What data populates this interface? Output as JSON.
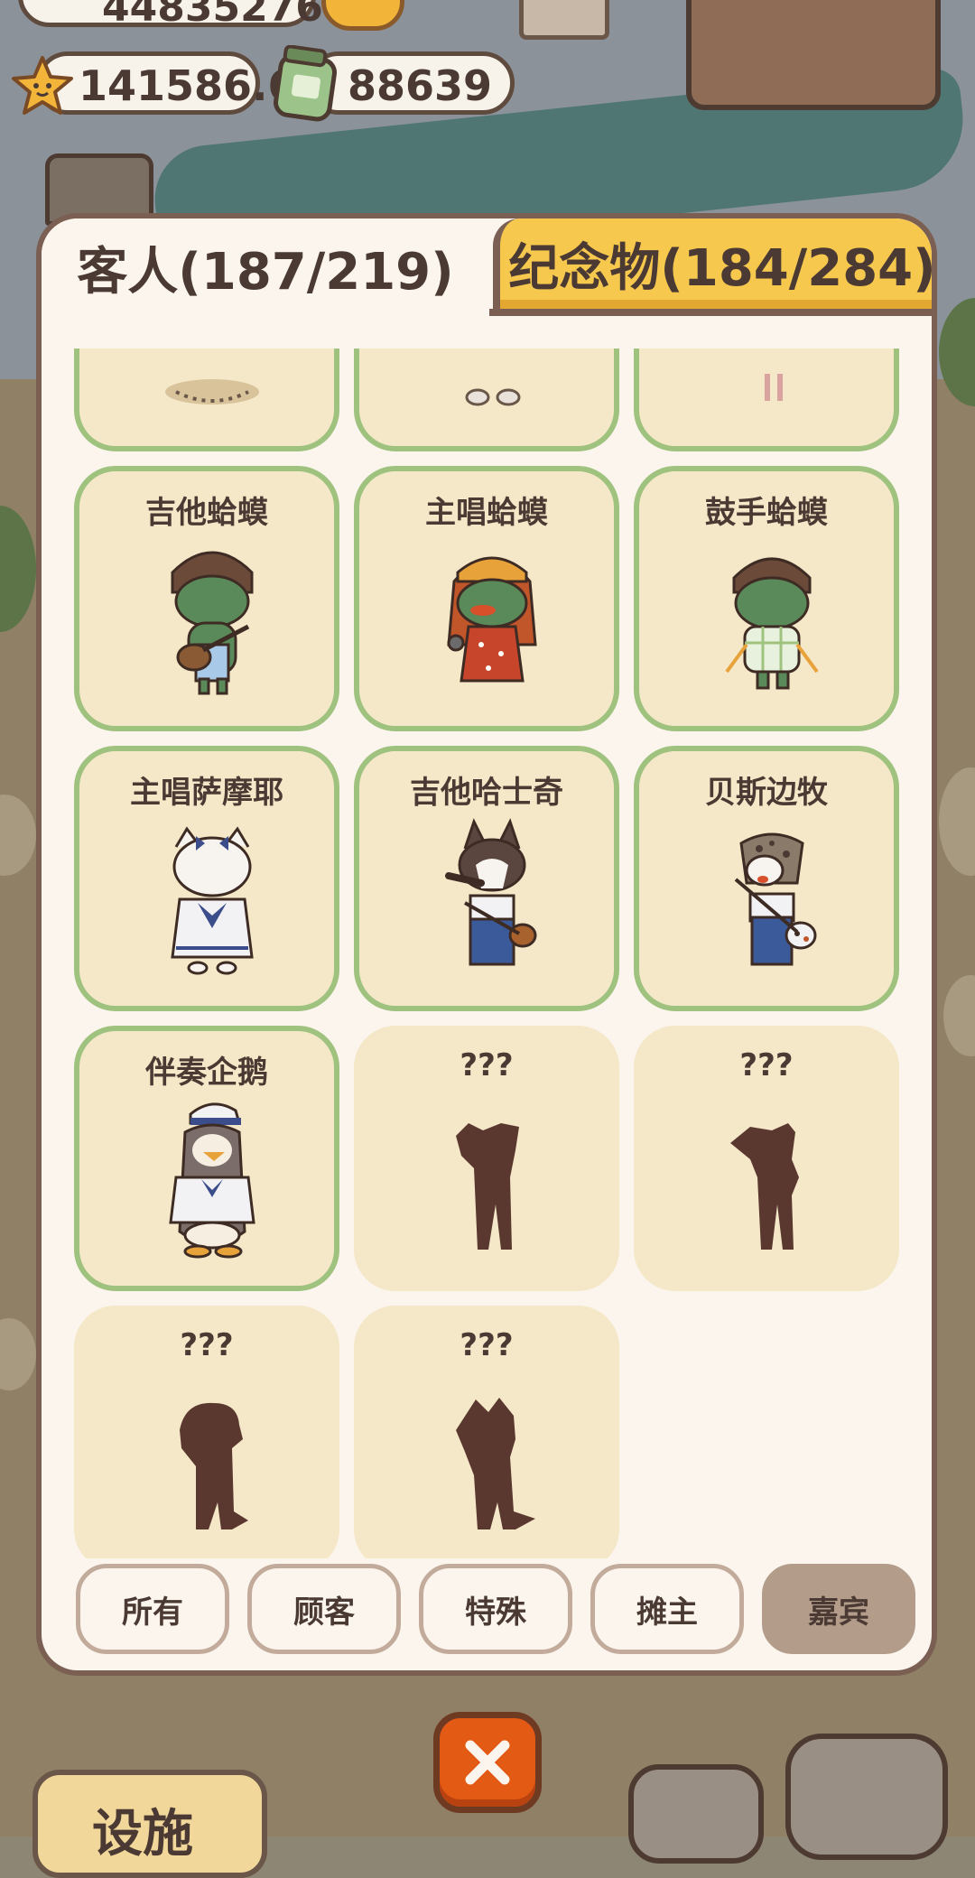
{
  "top": {
    "partial_value": "44835276"
  },
  "currency": {
    "stars": "141586.6",
    "cash": "88639"
  },
  "tabs": {
    "guests": "客人(187/219)",
    "souvenirs": "纪念物(184/284)"
  },
  "guests": [
    {
      "name": "",
      "unlocked": true,
      "color": "#5b8a5a"
    },
    {
      "name": "",
      "unlocked": true,
      "color": "#e8e2da"
    },
    {
      "name": "",
      "unlocked": true,
      "color": "#e8e2da"
    },
    {
      "name": "吉他蛤蟆",
      "unlocked": true,
      "color": "#5b8a5a"
    },
    {
      "name": "主唱蛤蟆",
      "unlocked": true,
      "color": "#5b8a5a"
    },
    {
      "name": "鼓手蛤蟆",
      "unlocked": true,
      "color": "#5b8a5a"
    },
    {
      "name": "主唱萨摩耶",
      "unlocked": true,
      "color": "#f7f3ee"
    },
    {
      "name": "吉他哈士奇",
      "unlocked": true,
      "color": "#6b574a"
    },
    {
      "name": "贝斯边牧",
      "unlocked": true,
      "color": "#8a7a6a"
    },
    {
      "name": "伴奏企鹅",
      "unlocked": true,
      "color": "#7a6d6a"
    },
    {
      "name": "???",
      "unlocked": false,
      "color": "#5a3830"
    },
    {
      "name": "???",
      "unlocked": false,
      "color": "#5a3830"
    },
    {
      "name": "???",
      "unlocked": false,
      "color": "#5a3830"
    },
    {
      "name": "???",
      "unlocked": false,
      "color": "#5a3830"
    }
  ],
  "filters": [
    {
      "label": "所有",
      "active": false
    },
    {
      "label": "顾客",
      "active": false
    },
    {
      "label": "特殊",
      "active": false
    },
    {
      "label": "摊主",
      "active": false
    },
    {
      "label": "嘉宾",
      "active": true
    }
  ],
  "bottom": {
    "left_label": "设施"
  },
  "icons": {
    "close": "close-icon",
    "star": "star-icon",
    "cash": "cash-jar-icon",
    "camera": "camera-icon",
    "whistle": "whistle-icon"
  },
  "colors": {
    "accent_tab": "#f7c84e",
    "card_bg": "#f5e8c8",
    "card_border": "#9fc27f",
    "close": "#e25a14"
  }
}
